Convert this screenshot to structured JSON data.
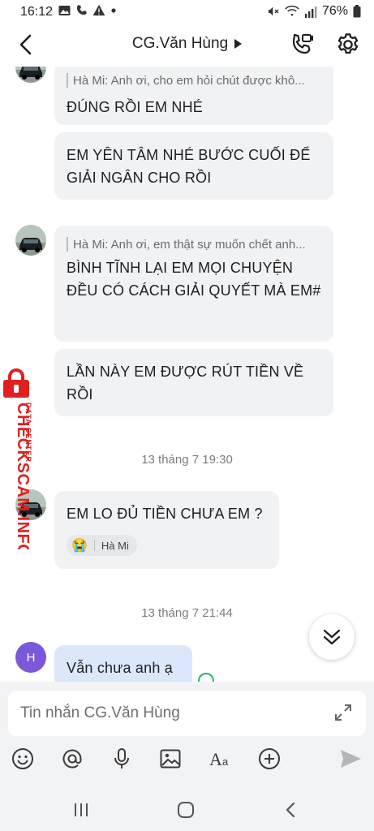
{
  "status_bar": {
    "time": "16:12",
    "battery": "76%",
    "left_icons": [
      "image-icon",
      "phone-icon",
      "warning-icon",
      "dot-icon"
    ],
    "right_icons": [
      "mute-icon",
      "wifi-icon",
      "signal-icon",
      "battery-icon"
    ]
  },
  "header": {
    "title": "CG.Văn Hùng",
    "icons": [
      "back-icon",
      "phone-call-icon",
      "gear-icon"
    ]
  },
  "messages": [
    {
      "quote": "Hà Mi: Anh ơi, cho em hỏi chút được khô...",
      "text": "ĐÚNG RỒI EM NHÉ"
    },
    {
      "text": "EM YÊN TÂM NHÉ BƯỚC CUỐI ĐỂ GIẢI NGÂN CHO RỒI"
    },
    {
      "quote": "Hà Mi: Anh ơi, em thật sự muốn chết anh...",
      "text": "BÌNH TĨNH LẠI EM MỌI  CHUYỆN ĐỀU CÓ CÁCH GIẢI QUYẾT MÀ EM#"
    },
    {
      "text": "LẦN NÀY EM ĐƯỢC RÚT TIỀN VỀ RỒI"
    },
    {
      "text": "EM LO ĐỦ TIỀN CHƯA EM ?",
      "reaction_user": "Hà Mi",
      "reaction_emoji": "😭"
    }
  ],
  "timestamps": [
    "13 tháng 7 19:30",
    "13 tháng 7 21:44"
  ],
  "my_message": {
    "avatar_letter": "H",
    "text": "Vẫn chưa anh ạ"
  },
  "watermark": {
    "brand": "CHECKSCAM.INFO",
    "tagline": "DATA CENTER"
  },
  "composer": {
    "placeholder": "Tin nhắn CG.Văn Hùng"
  },
  "toolbar": [
    "emoji-icon",
    "mention-icon",
    "microphone-icon",
    "image-icon",
    "text-format-icon",
    "add-icon",
    "send-icon"
  ],
  "navbar": [
    "recent-apps-icon",
    "home-icon",
    "back-nav-icon"
  ],
  "colors": {
    "bubble": "#f1f2f4",
    "my_bubble": "#dbe8fb",
    "accent": "#7b57d9",
    "watermark": "#e02020"
  }
}
